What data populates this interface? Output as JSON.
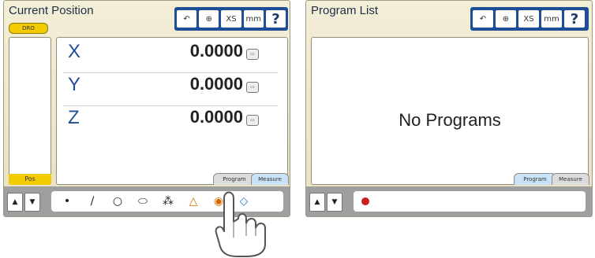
{
  "screen1": {
    "title": "Current Position",
    "dro_label": "DRO",
    "pos_label": "Pos",
    "iconbar": {
      "undo_icon": "undo-icon",
      "target_icon": "target-icon",
      "xs_label": "XS",
      "mm_label": "mm",
      "help_label": "?"
    },
    "axes": [
      {
        "label": "X",
        "value": "0.0000",
        "button": "zero"
      },
      {
        "label": "Y",
        "value": "0.0000",
        "button": "zero"
      },
      {
        "label": "Z",
        "value": "0.0000",
        "button": "zero"
      }
    ],
    "tabs": {
      "program": "Program",
      "measure": "Measure"
    },
    "toolbar": {
      "up": "▲",
      "down": "▼",
      "tools": [
        "•",
        "/",
        "○",
        "⬭",
        "⁂",
        "△",
        "◉",
        "◇"
      ]
    }
  },
  "screen2": {
    "title": "Program List",
    "iconbar": {
      "undo_icon": "undo-icon",
      "target_icon": "target-icon",
      "xs_label": "XS",
      "mm_label": "mm",
      "help_label": "?"
    },
    "message": "No Programs",
    "tabs": {
      "program": "Program",
      "measure": "Measure"
    },
    "toolbar": {
      "up": "▲",
      "down": "▼"
    }
  },
  "colors": {
    "accent": "#1f4e99",
    "highlight": "#f2cc00",
    "record": "#cc1f1f"
  }
}
